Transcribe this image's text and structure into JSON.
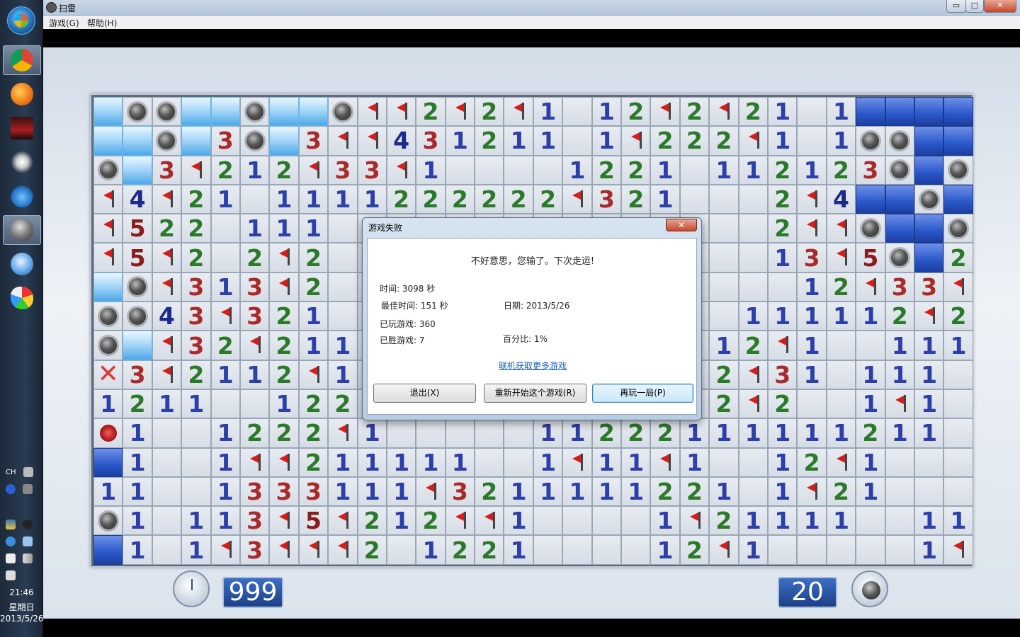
{
  "window": {
    "title": "扫雷",
    "controls": {
      "minimize": "▭",
      "maximize": "□",
      "close": "✕"
    }
  },
  "menu": [
    "游戏(G)",
    "帮助(H)"
  ],
  "taskbar": {
    "apps": [
      "chrome-icon",
      "firefox-icon",
      "game-icon",
      "burst-icon",
      "media-icon",
      "minesweeper-icon",
      "qq-icon",
      "paint-icon"
    ],
    "tray": {
      "lang": "CH",
      "time": "21:46",
      "weekday": "星期日",
      "date": "2013/5/26"
    }
  },
  "board": {
    "rows": [
      [
        "lb",
        "mine",
        "mine",
        "lb",
        "lb",
        "mine",
        "lb",
        "lb",
        "mine",
        "flag",
        "flag",
        "2",
        "flag",
        "2",
        "flag",
        "1",
        "rev",
        "1",
        "2",
        "flag",
        "2",
        "flag",
        "2",
        "1",
        "rev",
        "1",
        "db",
        "db",
        "db",
        "db"
      ],
      [
        "lb",
        "lb",
        "mine",
        "lb",
        "3",
        "mine",
        "lb",
        "3",
        "flag",
        "flag",
        "4",
        "3",
        "1",
        "2",
        "1",
        "1",
        "rev",
        "1",
        "flag",
        "2",
        "2",
        "2",
        "flag",
        "1",
        "rev",
        "1",
        "mine",
        "mine",
        "db",
        "db"
      ],
      [
        "mine",
        "lb",
        "3",
        "flag",
        "2",
        "1",
        "2",
        "flag",
        "3",
        "3",
        "flag",
        "1",
        "rev",
        "rev",
        "rev",
        "rev",
        "1",
        "2",
        "2",
        "1",
        "rev",
        "1",
        "1",
        "2",
        "1",
        "2",
        "3",
        "mine",
        "db",
        "mine"
      ],
      [
        "flag",
        "4",
        "flag",
        "2",
        "1",
        "rev",
        "1",
        "1",
        "1",
        "1",
        "2",
        "2",
        "2",
        "2",
        "2",
        "2",
        "flag",
        "3",
        "2",
        "1",
        "rev",
        "rev",
        "rev",
        "2",
        "flag",
        "4",
        "db",
        "db",
        "mine",
        "db"
      ],
      [
        "flag",
        "5",
        "2",
        "2",
        "rev",
        "1",
        "1",
        "1",
        "rev",
        "rev",
        "rev",
        "rev",
        "rev",
        "rev",
        "rev",
        "rev",
        "rev",
        "rev",
        "rev",
        "rev",
        "rev",
        "rev",
        "rev",
        "2",
        "flag",
        "flag",
        "mine",
        "db",
        "db",
        "mine"
      ],
      [
        "flag",
        "5",
        "flag",
        "2",
        "rev",
        "2",
        "flag",
        "2",
        "rev",
        "rev",
        "rev",
        "rev",
        "rev",
        "rev",
        "rev",
        "rev",
        "rev",
        "rev",
        "rev",
        "rev",
        "rev",
        "rev",
        "rev",
        "1",
        "3",
        "flag",
        "5",
        "mine",
        "db",
        "2"
      ],
      [
        "lb",
        "mine",
        "flag",
        "3",
        "1",
        "3",
        "flag",
        "2",
        "rev",
        "rev",
        "rev",
        "rev",
        "rev",
        "rev",
        "rev",
        "rev",
        "rev",
        "rev",
        "rev",
        "rev",
        "rev",
        "rev",
        "rev",
        "rev",
        "1",
        "2",
        "flag",
        "3",
        "3",
        "flag"
      ],
      [
        "mine",
        "mine",
        "4",
        "3",
        "flag",
        "3",
        "2",
        "1",
        "rev",
        "rev",
        "rev",
        "rev",
        "rev",
        "rev",
        "rev",
        "rev",
        "rev",
        "rev",
        "rev",
        "rev",
        "rev",
        "rev",
        "1",
        "1",
        "1",
        "1",
        "1",
        "2",
        "flag",
        "2"
      ],
      [
        "mine",
        "lb",
        "flag",
        "3",
        "2",
        "flag",
        "2",
        "1",
        "1",
        "rev",
        "rev",
        "rev",
        "rev",
        "rev",
        "rev",
        "rev",
        "rev",
        "rev",
        "rev",
        "rev",
        "rev",
        "1",
        "2",
        "flag",
        "1",
        "rev",
        "rev",
        "1",
        "1",
        "1"
      ],
      [
        "cross",
        "3",
        "flag",
        "2",
        "1",
        "1",
        "2",
        "flag",
        "1",
        "rev",
        "rev",
        "rev",
        "rev",
        "rev",
        "rev",
        "rev",
        "rev",
        "rev",
        "rev",
        "rev",
        "rev",
        "2",
        "flag",
        "3",
        "1",
        "rev",
        "1",
        "1",
        "1",
        "rev"
      ],
      [
        "1",
        "2",
        "1",
        "1",
        "rev",
        "rev",
        "1",
        "2",
        "2",
        "rev",
        "rev",
        "rev",
        "rev",
        "rev",
        "rev",
        "rev",
        "rev",
        "rev",
        "rev",
        "rev",
        "rev",
        "2",
        "flag",
        "2",
        "rev",
        "rev",
        "1",
        "flag",
        "1",
        "rev"
      ],
      [
        "red",
        "1",
        "rev",
        "rev",
        "1",
        "2",
        "2",
        "2",
        "flag",
        "1",
        "rev",
        "rev",
        "rev",
        "rev",
        "rev",
        "1",
        "1",
        "2",
        "2",
        "2",
        "1",
        "1",
        "1",
        "1",
        "1",
        "1",
        "2",
        "1",
        "1",
        "rev"
      ],
      [
        "db",
        "1",
        "rev",
        "rev",
        "1",
        "flag",
        "flag",
        "2",
        "1",
        "1",
        "1",
        "1",
        "1",
        "rev",
        "rev",
        "1",
        "flag",
        "1",
        "1",
        "flag",
        "1",
        "rev",
        "rev",
        "1",
        "2",
        "flag",
        "1",
        "rev",
        "rev",
        "rev"
      ],
      [
        "1",
        "1",
        "rev",
        "rev",
        "1",
        "3",
        "3",
        "3",
        "1",
        "1",
        "1",
        "flag",
        "3",
        "2",
        "1",
        "1",
        "1",
        "1",
        "1",
        "2",
        "2",
        "1",
        "rev",
        "1",
        "flag",
        "2",
        "1",
        "rev",
        "rev",
        "rev"
      ],
      [
        "mine",
        "1",
        "rev",
        "1",
        "1",
        "3",
        "flag",
        "5",
        "flag",
        "2",
        "1",
        "2",
        "flag",
        "flag",
        "1",
        "rev",
        "rev",
        "rev",
        "rev",
        "1",
        "flag",
        "2",
        "1",
        "1",
        "1",
        "1",
        "rev",
        "rev",
        "1",
        "1"
      ],
      [
        "db",
        "1",
        "rev",
        "1",
        "flag",
        "3",
        "flag",
        "flag",
        "flag",
        "2",
        "rev",
        "1",
        "2",
        "2",
        "1",
        "rev",
        "rev",
        "rev",
        "rev",
        "1",
        "2",
        "flag",
        "1",
        "rev",
        "rev",
        "rev",
        "rev",
        "rev",
        "1",
        "flag"
      ]
    ]
  },
  "counters": {
    "time": "999",
    "mines": "20"
  },
  "dialog": {
    "title": "游戏失败",
    "close": "✕",
    "message": "不好意思，您输了。下次走运!",
    "time": "时间: 3098 秒",
    "best_time": "最佳时间: 151 秒",
    "date": "日期: 2013/5/26",
    "played": "已玩游戏: 360",
    "won": "已胜游戏: 7",
    "percent": "百分比: 1%",
    "link": "联机获取更多游戏",
    "buttons": {
      "exit": "退出(X)",
      "restart": "重新开始这个游戏(R)",
      "play_again": "再玩一局(P)"
    }
  },
  "colors": {
    "accent": "#2a57c9",
    "light_blue": "#a8d8f8",
    "board_bg": "#d7dde6"
  }
}
